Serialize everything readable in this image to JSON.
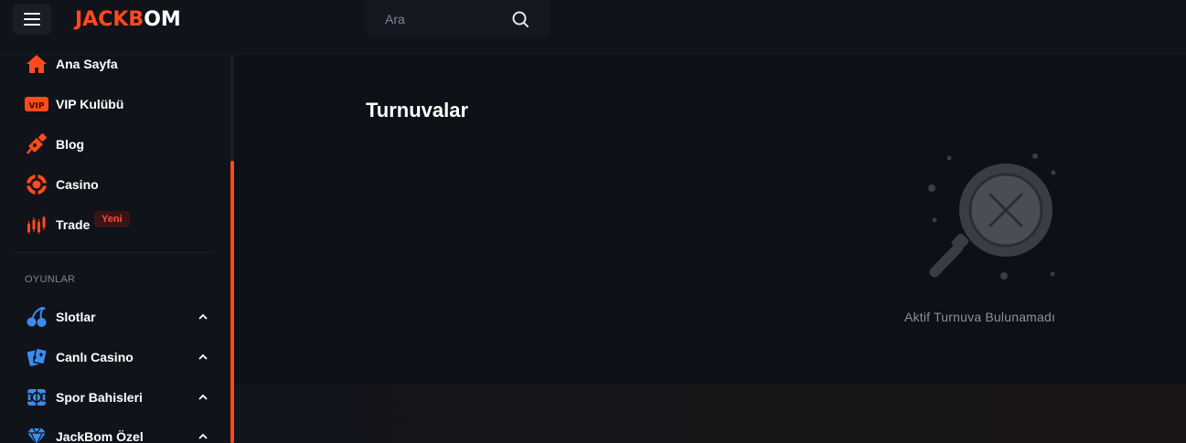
{
  "header": {
    "logo_part1": "JACKB",
    "logo_part2": "OM",
    "search": {
      "placeholder": "Ara"
    }
  },
  "sidebar": {
    "items": [
      {
        "label": "Ana Sayfa",
        "icon": "home-icon"
      },
      {
        "label": "VIP Kulübü",
        "icon": "vip-icon"
      },
      {
        "label": "Blog",
        "icon": "blog-icon"
      },
      {
        "label": "Casino",
        "icon": "casino-chip-icon"
      },
      {
        "label": "Trade",
        "icon": "trade-chart-icon",
        "badge": "Yeni"
      }
    ],
    "section_title": "OYUNLAR",
    "games": [
      {
        "label": "Slotlar",
        "icon": "cherries-icon"
      },
      {
        "label": "Canlı Casino",
        "icon": "cards-icon"
      },
      {
        "label": "Spor Bahisleri",
        "icon": "sports-icon"
      },
      {
        "label": "JackBom Özel",
        "icon": "diamond-icon"
      }
    ]
  },
  "main": {
    "title": "Turnuvalar",
    "empty_message": "Aktif Turnuva Bulunamadı"
  },
  "colors": {
    "accent": "#ff4a1c",
    "game_icons": "#3b8cf0",
    "background": "#0d1016",
    "sidebar": "#10131a"
  }
}
